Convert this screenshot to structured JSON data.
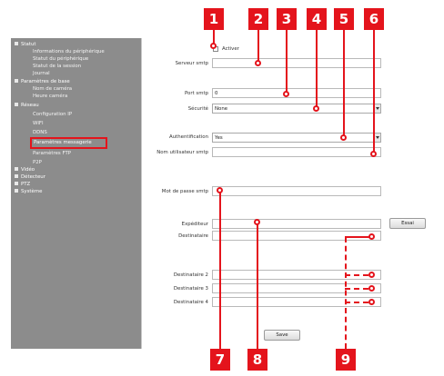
{
  "sidebar": {
    "sections": [
      {
        "label": "Statut",
        "items": [
          "Informations du périphérique",
          "Statut du périphérique",
          "Statut de la session",
          "Journal"
        ]
      },
      {
        "label": "Paramètres de base",
        "items": [
          "Nom de caméra",
          "Heure caméra"
        ]
      },
      {
        "label": "Réseau",
        "items": [
          "Configuration IP",
          "WIFI",
          "DDNS",
          "Paramètres messagerie",
          "Paramètres FTP",
          "P2P"
        ]
      },
      {
        "label": "Vidéo",
        "items": []
      },
      {
        "label": "Détecteur",
        "items": []
      },
      {
        "label": "PTZ",
        "items": []
      },
      {
        "label": "Système",
        "items": []
      }
    ],
    "active_item": "Paramètres messagerie"
  },
  "form": {
    "enable_label": "Activer",
    "smtp_server_label": "Serveur smtp",
    "smtp_server_value": "",
    "smtp_port_label": "Port smtp",
    "smtp_port_value": "0",
    "security_label": "Sécurité",
    "security_value": "None",
    "auth_label": "Authentification",
    "auth_value": "Yes",
    "smtp_user_label": "Nom utilisateur smtp",
    "smtp_user_value": "",
    "smtp_password_label": "Mot de passe smtp",
    "smtp_password_value": "",
    "sender_label": "Expéditeur",
    "sender_value": "",
    "test_button": "Essai",
    "recipient_label": "Destinataire",
    "recipient_value": "",
    "recipient2_label": "Destinataire 2",
    "recipient3_label": "Destinataire 3",
    "recipient4_label": "Destinataire 4",
    "save_button": "Save"
  },
  "callouts": [
    "1",
    "2",
    "3",
    "4",
    "5",
    "6",
    "7",
    "8",
    "9"
  ],
  "colors": {
    "callout": "#e4141c",
    "sidebar_bg": "#8c8c8c"
  }
}
